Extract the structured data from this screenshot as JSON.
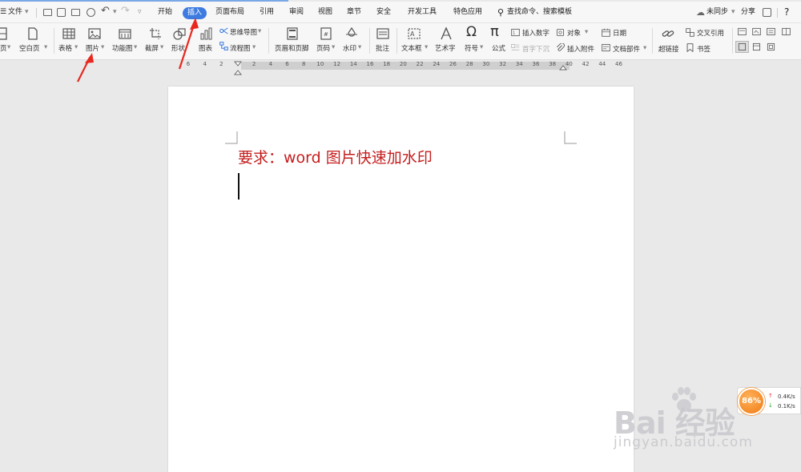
{
  "menubar": {
    "file_label": "文件",
    "tabs": [
      "开始",
      "插入",
      "页面布局",
      "引用",
      "审阅",
      "视图",
      "章节",
      "安全",
      "开发工具",
      "特色应用"
    ],
    "active_tab": "插入",
    "search_label": "查找命令、搜索模板",
    "sync_label": "未同步",
    "share_label": "分享",
    "help_label": "?"
  },
  "ribbon": {
    "page_cut": "页",
    "blank_page": "空白页",
    "table": "表格",
    "picture": "图片",
    "function_chart": "功能图",
    "screenshot": "截屏",
    "shape": "形状",
    "chart": "图表",
    "mindmap": "思维导图",
    "flowchart": "流程图",
    "header_footer": "页眉和页脚",
    "page_number": "页码",
    "watermark": "水印",
    "comment": "批注",
    "textbox": "文本框",
    "wordart": "艺术字",
    "symbol": "符号",
    "formula": "公式",
    "insert_number": "插入数字",
    "dropcap": "首字下沉",
    "object": "对象",
    "insert_attachment": "插入附件",
    "date": "日期",
    "doc_parts": "文档部件",
    "hyperlink": "超链接",
    "cross_ref": "交叉引用",
    "bookmark": "书签"
  },
  "ruler": {
    "ticks": [
      "6",
      "4",
      "2",
      "2",
      "4",
      "6",
      "8",
      "10",
      "12",
      "14",
      "16",
      "18",
      "20",
      "22",
      "24",
      "26",
      "28",
      "30",
      "32",
      "34",
      "36",
      "38",
      "40",
      "42",
      "44",
      "46"
    ]
  },
  "document": {
    "title": "要求：word 图片快速加水印"
  },
  "speed_widget": {
    "percent": "86%",
    "upload": "0.4K/s",
    "download": "0.1K/s"
  },
  "watermark": {
    "brand": "Bai 经验",
    "url": "jingyan.baidu.com"
  },
  "colors": {
    "accent_blue": "#3d7be0",
    "title_red": "#c41e1e",
    "arrow_red": "#e8281e"
  }
}
